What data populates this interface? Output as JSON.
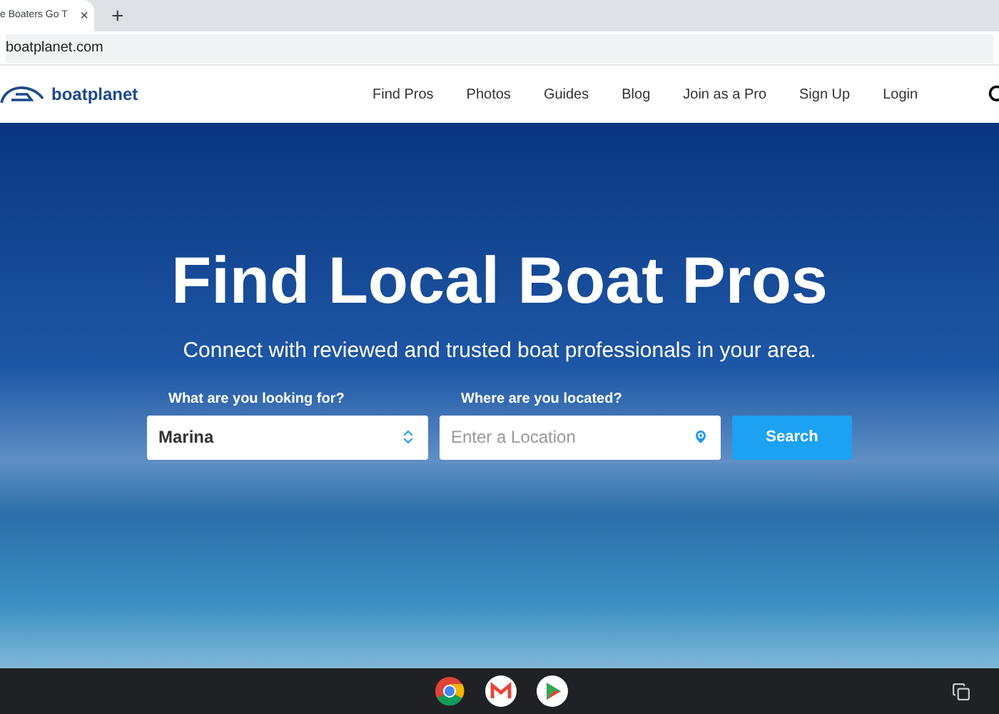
{
  "browser": {
    "tab_title": "e Boaters Go T",
    "new_tab": "+",
    "close_tab": "×",
    "url": "boatplanet.com"
  },
  "site": {
    "logo_text": "boatplanet",
    "nav": [
      {
        "label": "Find Pros"
      },
      {
        "label": "Photos"
      },
      {
        "label": "Guides"
      },
      {
        "label": "Blog"
      },
      {
        "label": "Join as a Pro"
      },
      {
        "label": "Sign Up"
      },
      {
        "label": "Login"
      }
    ]
  },
  "hero": {
    "title": "Find Local Boat Pros",
    "subtitle": "Connect with reviewed and trusted boat professionals in your area.",
    "service_field": {
      "label": "What are you looking for?",
      "value": "Marina"
    },
    "location_field": {
      "label": "Where are you located?",
      "placeholder": "Enter a Location"
    },
    "search_button": "Search"
  }
}
